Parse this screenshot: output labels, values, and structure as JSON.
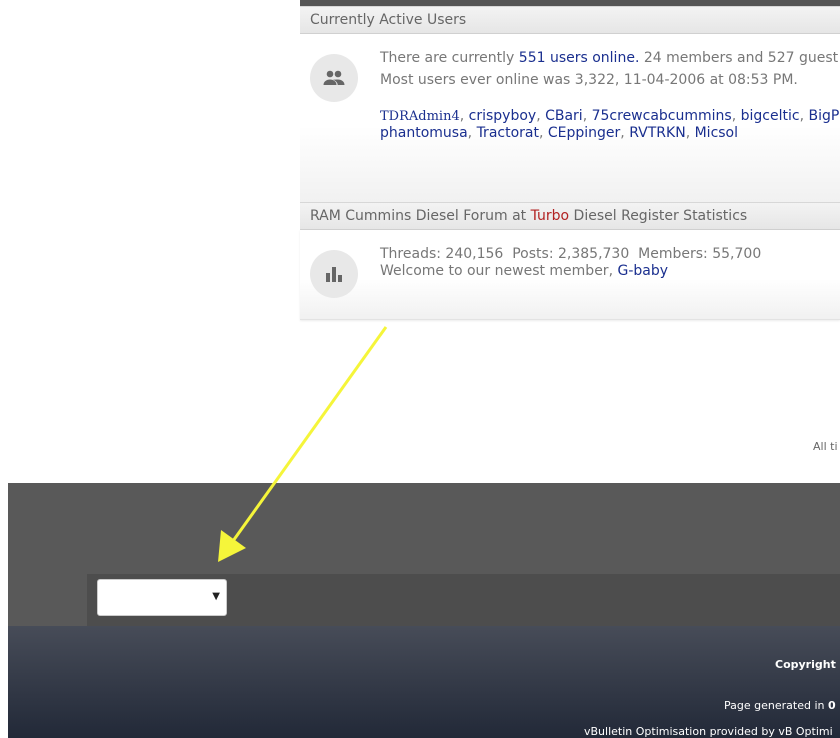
{
  "active_users": {
    "title": "Currently Active Users",
    "online_prefix": "There are currently ",
    "online_link": "551 users online.",
    "online_suffix": " 24 members and 527 guest",
    "most_ever": "Most users ever online was 3,322, 11-04-2006 at 08:53 PM.",
    "users_line1": [
      "TDRAdmin4",
      "crispyboy",
      "CBari",
      "75crewcabcummins",
      "bigceltic",
      "BigP"
    ],
    "users_line2": [
      "phantomusa",
      "Tractorat",
      "CEppinger",
      "RVTRKN",
      "Micsol"
    ],
    "icon": "users-icon"
  },
  "statistics": {
    "title_prefix": "RAM Cummins Diesel Forum at ",
    "title_highlight": "Turbo",
    "title_suffix": " Diesel Register Statistics",
    "threads_label": "Threads:",
    "threads": "240,156",
    "posts_label": "Posts:",
    "posts": "2,385,730",
    "members_label": "Members:",
    "members": "55,700",
    "welcome_prefix": "Welcome to our newest member, ",
    "newest_member": "G-baby",
    "icon": "bar-chart-icon"
  },
  "times_note": "All ti",
  "footer": {
    "copyright": "Copyright ©",
    "page_generated_prefix": "Page generated in ",
    "page_generated_value": "0",
    "optimisation": "vBulletin Optimisation provided by vB Optimi",
    "style_select_value": ""
  },
  "colors": {
    "link": "#1a2f8f",
    "highlight": "#b22222",
    "annotation_arrow": "#f5f53a"
  }
}
